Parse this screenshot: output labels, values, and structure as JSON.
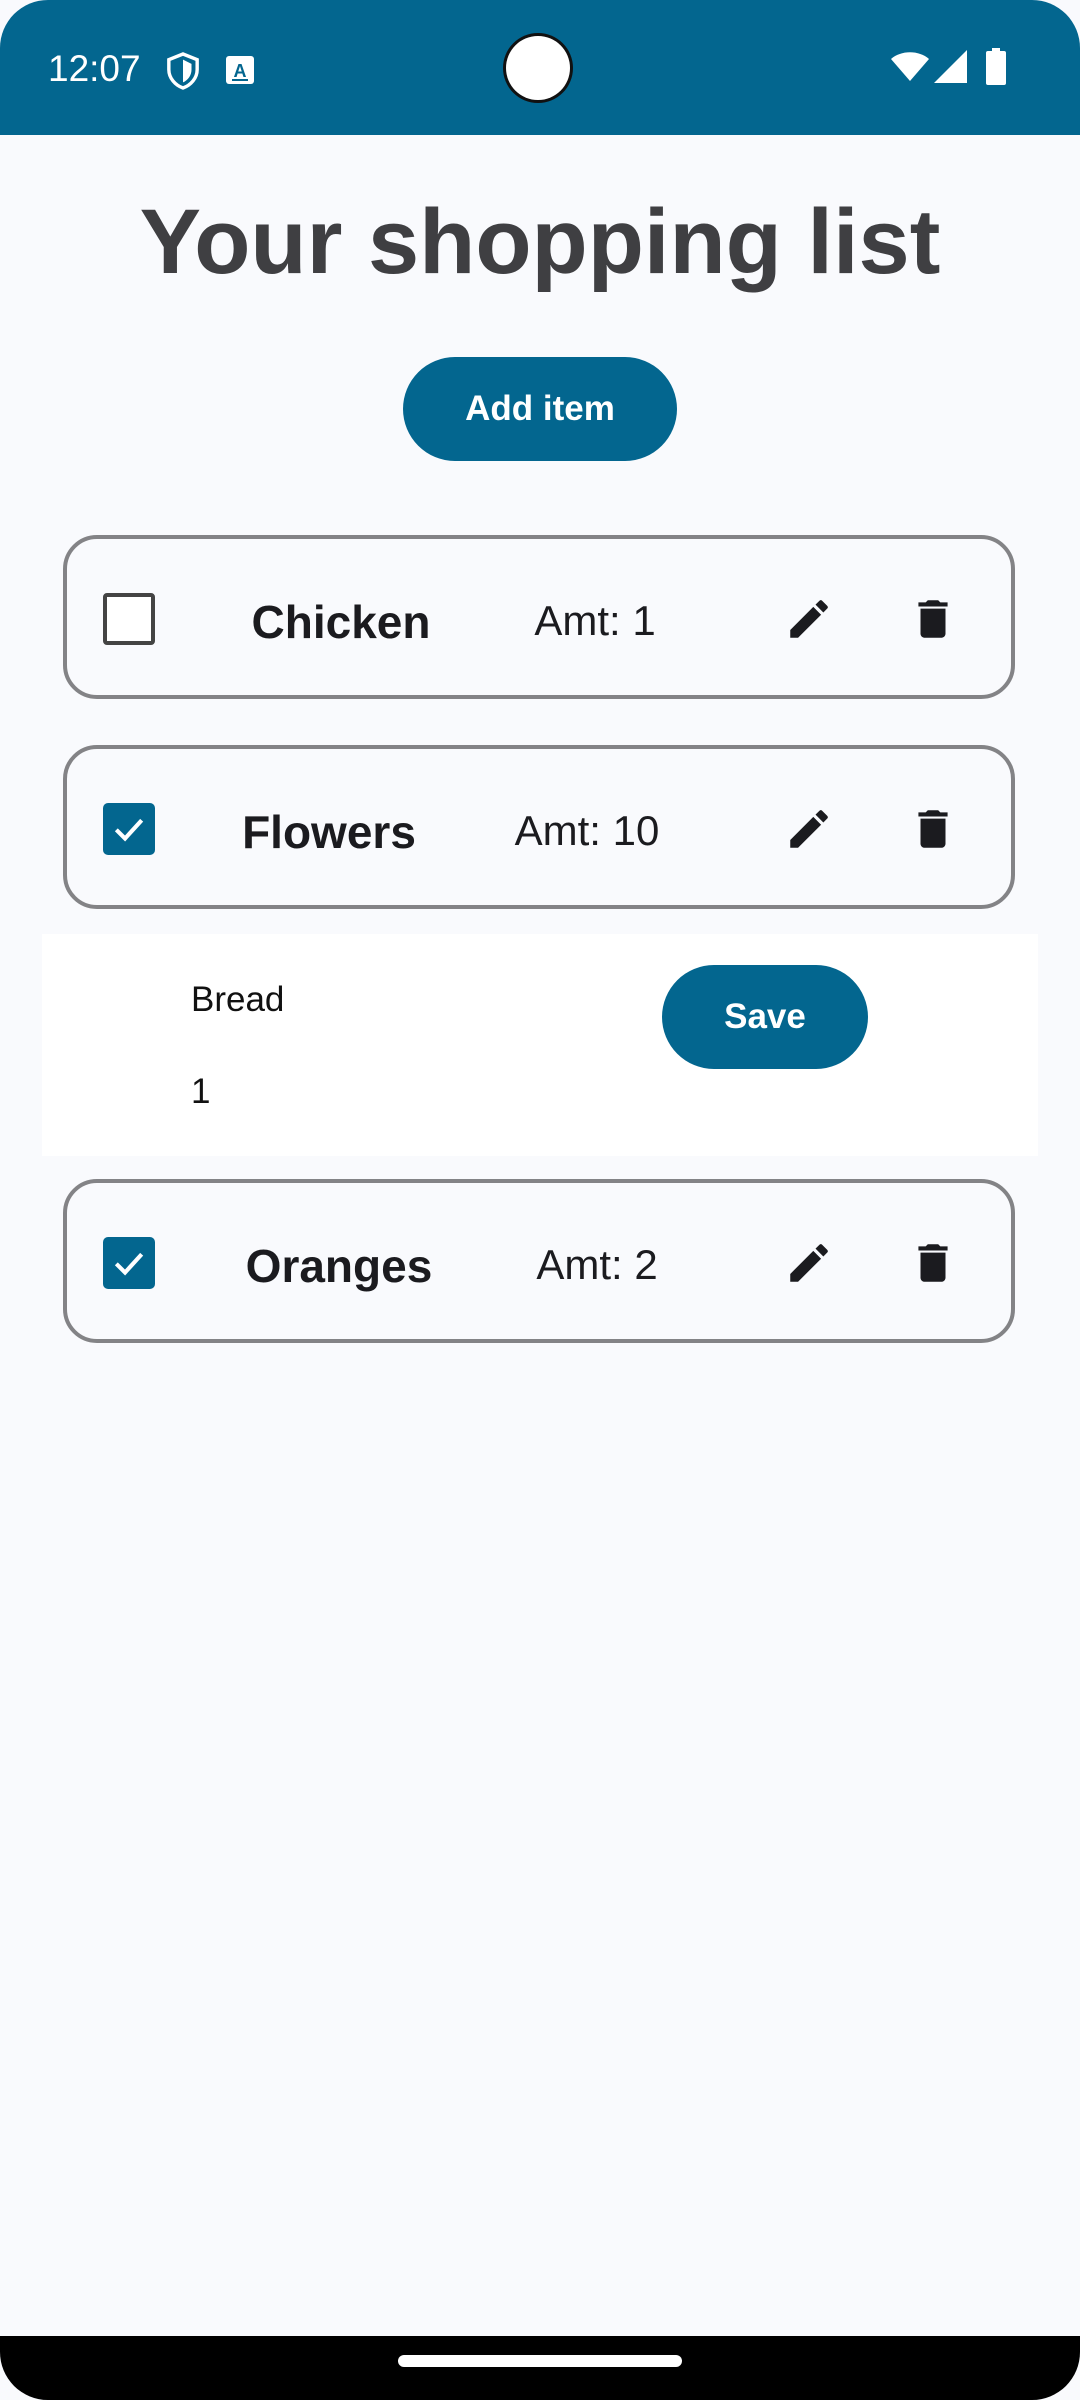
{
  "status_bar": {
    "time": "12:07",
    "icons": [
      "shield-icon",
      "translate-icon",
      "wifi-icon",
      "signal-icon",
      "battery-icon"
    ],
    "background": "#03668f"
  },
  "page": {
    "title": "Your shopping list",
    "add_button_label": "Add item"
  },
  "items": [
    {
      "name": "Chicken",
      "amount_text": "Amt: 1",
      "checked": false
    },
    {
      "name": "Flowers",
      "amount_text": "Amt: 10",
      "checked": true
    },
    {
      "name": "Oranges",
      "amount_text": "Amt: 2",
      "checked": true
    }
  ],
  "edit_form": {
    "name_value": "Bread",
    "amount_value": "1",
    "save_label": "Save"
  },
  "colors": {
    "accent": "#03668f",
    "background": "#f9fafd",
    "card_border": "#838386"
  }
}
